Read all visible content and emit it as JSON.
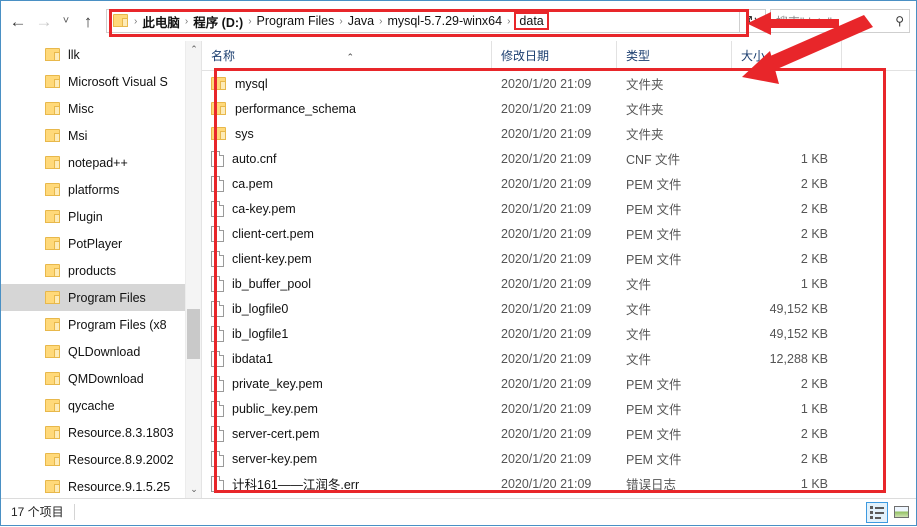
{
  "window": {
    "title": "data",
    "accent_border": "#4a90c4",
    "annotation_color": "#e8262a"
  },
  "nav": {
    "back_icon": "arrow-left-icon",
    "back_label": "←",
    "forward_icon": "arrow-right-icon",
    "forward_label": "→",
    "recent_icon": "chevron-down-icon",
    "recent_label": "˅",
    "up_icon": "arrow-up-icon",
    "up_label": "↑",
    "refresh_icon": "refresh-icon",
    "refresh_label": "↻"
  },
  "address": {
    "folder_icon": "folder-icon",
    "separator": "›",
    "crumbs": [
      {
        "label": "此电脑",
        "bold": true,
        "current": false
      },
      {
        "label": "程序 (D:)",
        "bold": true,
        "current": false
      },
      {
        "label": "Program Files",
        "bold": false,
        "current": false
      },
      {
        "label": "Java",
        "bold": false,
        "current": false
      },
      {
        "label": "mysql-5.7.29-winx64",
        "bold": false,
        "current": false
      },
      {
        "label": "data",
        "bold": false,
        "current": true
      }
    ]
  },
  "search": {
    "placeholder": "搜索\"data\"",
    "icon": "search-icon",
    "icon_glyph": "⚲"
  },
  "tree": {
    "scrollbar": {
      "up_icon": "chevron-up-icon",
      "up_glyph": "⌃",
      "down_icon": "chevron-down-icon",
      "down_glyph": "⌄"
    },
    "items": [
      {
        "label": "llk",
        "icon": "folder-icon",
        "selected": false
      },
      {
        "label": "Microsoft Visual S",
        "icon": "folder-icon",
        "selected": false
      },
      {
        "label": "Misc",
        "icon": "folder-icon",
        "selected": false
      },
      {
        "label": "Msi",
        "icon": "folder-icon",
        "selected": false
      },
      {
        "label": "notepad++",
        "icon": "folder-icon",
        "selected": false
      },
      {
        "label": "platforms",
        "icon": "folder-icon",
        "selected": false
      },
      {
        "label": "Plugin",
        "icon": "folder-icon",
        "selected": false
      },
      {
        "label": "PotPlayer",
        "icon": "folder-icon",
        "selected": false
      },
      {
        "label": "products",
        "icon": "folder-icon",
        "selected": false
      },
      {
        "label": "Program Files",
        "icon": "folder-icon",
        "selected": true
      },
      {
        "label": "Program Files (x8",
        "icon": "folder-icon",
        "selected": false
      },
      {
        "label": "QLDownload",
        "icon": "folder-icon",
        "selected": false
      },
      {
        "label": "QMDownload",
        "icon": "folder-icon",
        "selected": false
      },
      {
        "label": "qycache",
        "icon": "folder-icon",
        "selected": false
      },
      {
        "label": "Resource.8.3.1803",
        "icon": "folder-icon",
        "selected": false
      },
      {
        "label": "Resource.8.9.2002",
        "icon": "folder-icon",
        "selected": false
      },
      {
        "label": "Resource.9.1.5.25",
        "icon": "folder-icon",
        "selected": false
      }
    ]
  },
  "filelist": {
    "columns": [
      {
        "label": "名称",
        "key": "name",
        "sorted": true,
        "sort_glyph": "⌃"
      },
      {
        "label": "修改日期",
        "key": "date",
        "sorted": false,
        "sort_glyph": ""
      },
      {
        "label": "类型",
        "key": "type",
        "sorted": false,
        "sort_glyph": ""
      },
      {
        "label": "大小",
        "key": "size",
        "sorted": false,
        "sort_glyph": ""
      }
    ],
    "rows": [
      {
        "name": "mysql",
        "date": "2020/1/20 21:09",
        "type": "文件夹",
        "size": "",
        "icon": "folder-icon"
      },
      {
        "name": "performance_schema",
        "date": "2020/1/20 21:09",
        "type": "文件夹",
        "size": "",
        "icon": "folder-icon"
      },
      {
        "name": "sys",
        "date": "2020/1/20 21:09",
        "type": "文件夹",
        "size": "",
        "icon": "folder-icon"
      },
      {
        "name": "auto.cnf",
        "date": "2020/1/20 21:09",
        "type": "CNF 文件",
        "size": "1 KB",
        "icon": "file-icon"
      },
      {
        "name": "ca.pem",
        "date": "2020/1/20 21:09",
        "type": "PEM 文件",
        "size": "2 KB",
        "icon": "file-icon"
      },
      {
        "name": "ca-key.pem",
        "date": "2020/1/20 21:09",
        "type": "PEM 文件",
        "size": "2 KB",
        "icon": "file-icon"
      },
      {
        "name": "client-cert.pem",
        "date": "2020/1/20 21:09",
        "type": "PEM 文件",
        "size": "2 KB",
        "icon": "file-icon"
      },
      {
        "name": "client-key.pem",
        "date": "2020/1/20 21:09",
        "type": "PEM 文件",
        "size": "2 KB",
        "icon": "file-icon"
      },
      {
        "name": "ib_buffer_pool",
        "date": "2020/1/20 21:09",
        "type": "文件",
        "size": "1 KB",
        "icon": "file-icon"
      },
      {
        "name": "ib_logfile0",
        "date": "2020/1/20 21:09",
        "type": "文件",
        "size": "49,152 KB",
        "icon": "file-icon"
      },
      {
        "name": "ib_logfile1",
        "date": "2020/1/20 21:09",
        "type": "文件",
        "size": "49,152 KB",
        "icon": "file-icon"
      },
      {
        "name": "ibdata1",
        "date": "2020/1/20 21:09",
        "type": "文件",
        "size": "12,288 KB",
        "icon": "file-icon"
      },
      {
        "name": "private_key.pem",
        "date": "2020/1/20 21:09",
        "type": "PEM 文件",
        "size": "2 KB",
        "icon": "file-icon"
      },
      {
        "name": "public_key.pem",
        "date": "2020/1/20 21:09",
        "type": "PEM 文件",
        "size": "1 KB",
        "icon": "file-icon"
      },
      {
        "name": "server-cert.pem",
        "date": "2020/1/20 21:09",
        "type": "PEM 文件",
        "size": "2 KB",
        "icon": "file-icon"
      },
      {
        "name": "server-key.pem",
        "date": "2020/1/20 21:09",
        "type": "PEM 文件",
        "size": "2 KB",
        "icon": "file-icon"
      },
      {
        "name": "计科161——江润冬.err",
        "date": "2020/1/20 21:09",
        "type": "错误日志",
        "size": "1 KB",
        "icon": "file-icon"
      }
    ]
  },
  "statusbar": {
    "item_count_text": "17 个项目",
    "views": [
      {
        "name": "details-view",
        "active": true
      },
      {
        "name": "large-icons-view",
        "active": false
      }
    ]
  }
}
